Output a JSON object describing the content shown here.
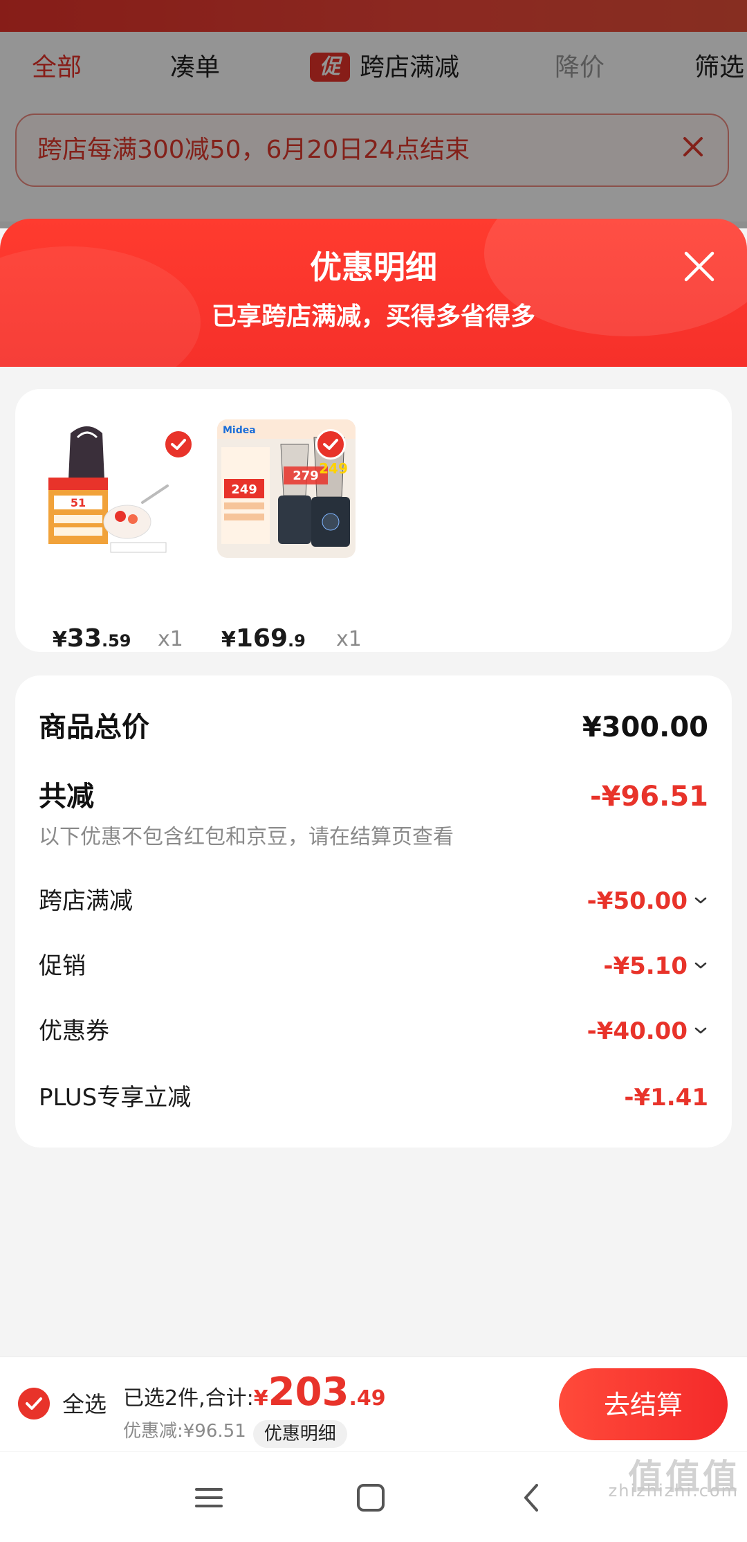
{
  "background": {
    "tabs": [
      {
        "label": "全部"
      },
      {
        "label": "凑单"
      },
      {
        "label": "跨店满减",
        "tag": "促"
      },
      {
        "label": "降价"
      },
      {
        "label": "筛选"
      }
    ],
    "notice": "跨店每满300减50，6月20日24点结束"
  },
  "sheet": {
    "title": "优惠明细",
    "subtitle": "已享跨店满减，买得多省得多"
  },
  "products": [
    {
      "currency": "¥",
      "price_int": "33",
      "price_dec": ".59",
      "qty": "x1",
      "checked": true
    },
    {
      "currency": "¥",
      "price_int": "169",
      "price_dec": ".9",
      "qty": "x1",
      "checked": true
    }
  ],
  "summary": {
    "total_label": "商品总价",
    "total_value": "¥300.00",
    "reduce_label": "共减",
    "reduce_value": "-¥96.51",
    "note": "以下优惠不包含红包和京豆，请在结算页查看",
    "items": [
      {
        "label": "跨店满减",
        "value": "-¥50.00",
        "expandable": true
      },
      {
        "label": "促销",
        "value": "-¥5.10",
        "expandable": true
      },
      {
        "label": "优惠券",
        "value": "-¥40.00",
        "expandable": true
      },
      {
        "label": "PLUS专享立减",
        "value": "-¥1.41",
        "expandable": false
      }
    ]
  },
  "bottom": {
    "select_all": "全选",
    "selected_text": "已选2件,合计:",
    "currency": "¥",
    "total_int": "203",
    "total_dec": ".49",
    "discount_text": "优惠减:¥96.51",
    "detail_label": "优惠明细",
    "checkout_label": "去结算"
  },
  "watermark": {
    "cn": "值值值",
    "url": "zhizhizhi.com"
  },
  "colors": {
    "accent": "#e8332a",
    "header_gradient": "#ff3b2f"
  }
}
